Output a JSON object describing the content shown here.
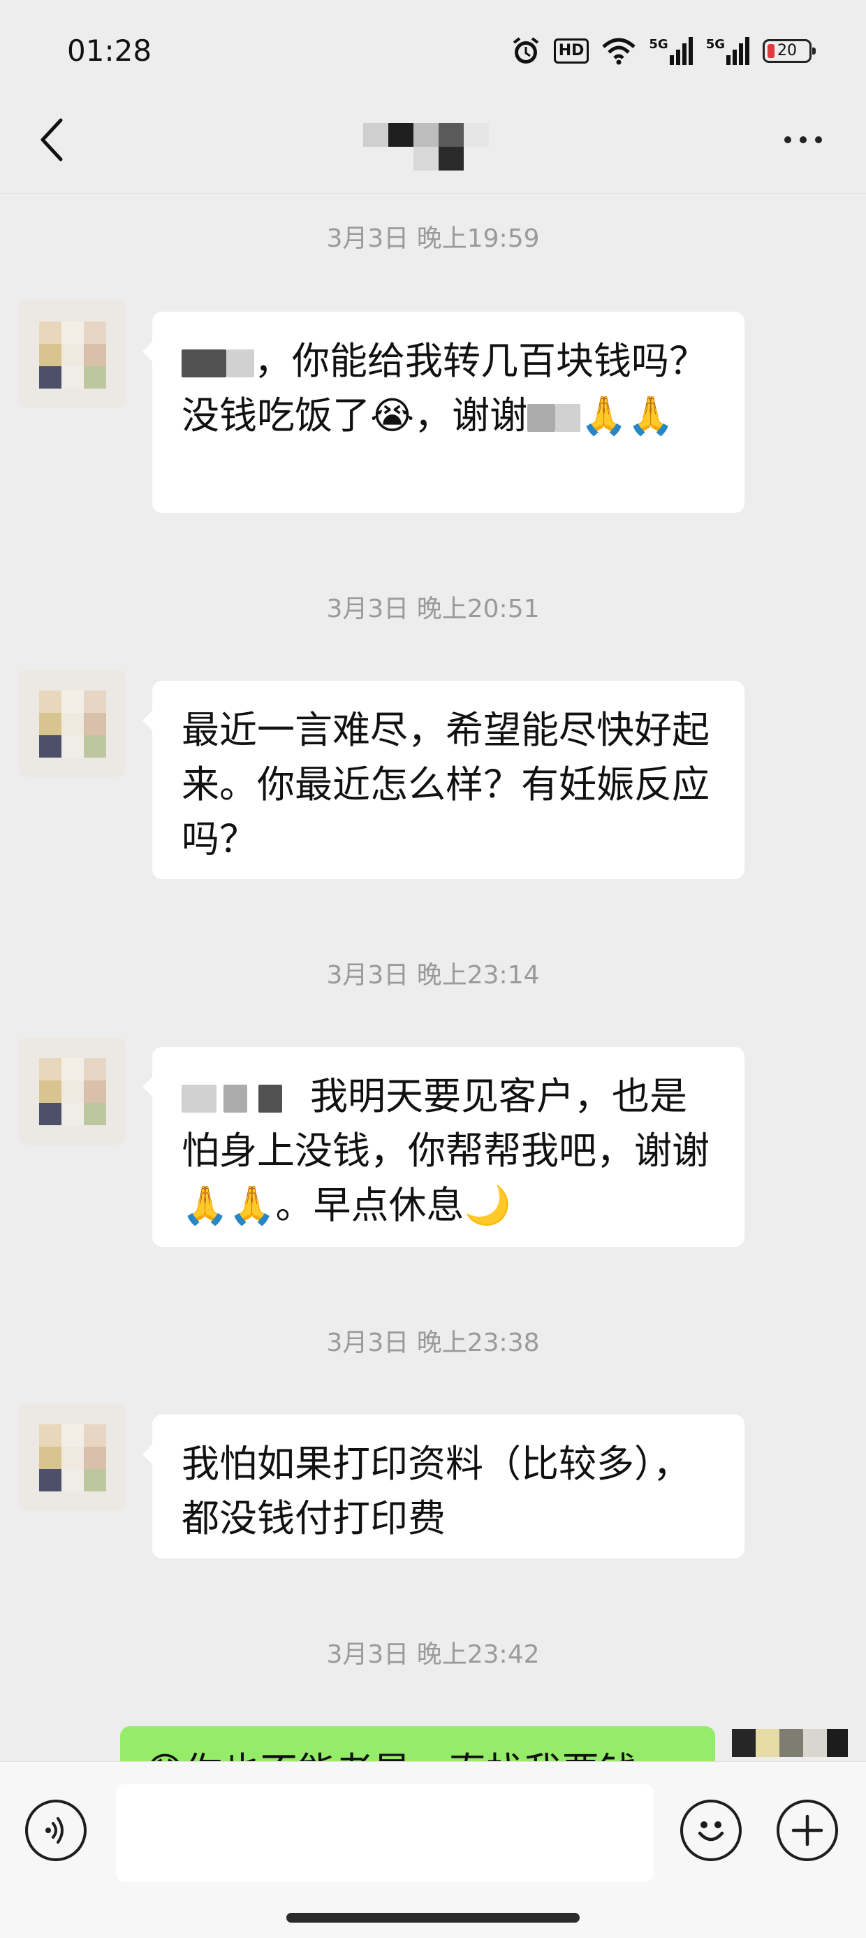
{
  "status_bar": {
    "time": "01:28",
    "hd_label": "HD",
    "network_1": "5G",
    "network_2": "5G",
    "battery_level": "20",
    "battery_color": "#e0393e",
    "icons": [
      "alarm-icon",
      "hd-icon",
      "wifi-icon",
      "signal-icon",
      "signal-icon",
      "battery-icon"
    ]
  },
  "header": {
    "back_icon": "chevron-left-icon",
    "more_icon": "more-dots-icon"
  },
  "messages": [
    {
      "timestamp": "3月3日 晚上19:59",
      "text_1": "，你能给我转几百块钱吗？没钱吃饭了",
      "emoji_1": "😭",
      "text_2": "，谢谢",
      "emoji_2": "🙏🙏"
    },
    {
      "timestamp": "3月3日 晚上20:51",
      "text": "最近一言难尽，希望能尽快好起来。你最近怎么样？有妊娠反应吗？"
    },
    {
      "timestamp": "3月3日 晚上23:14",
      "text_1": "我明天要见客户，也是怕身上没钱，你帮帮我吧，谢谢",
      "emoji_1": "🙏🙏",
      "text_2": "。早点休息",
      "emoji_2": "🌙"
    },
    {
      "timestamp": "3月3日 晚上23:38",
      "text": "我怕如果打印资料（比较多），都没钱付打印费"
    },
    {
      "timestamp": "3月3日 晚上23:42",
      "sent_text": "你也不能老是一直找我要钱",
      "sent_emoji": "😓"
    }
  ],
  "input_bar": {
    "voice_icon": "voice-icon",
    "emoji_icon": "emoji-icon",
    "plus_icon": "plus-icon",
    "placeholder": ""
  },
  "colors": {
    "background": "#ededed",
    "received_bubble": "#ffffff",
    "sent_bubble": "#95ec69",
    "timestamp_text": "#9a9a9a"
  }
}
